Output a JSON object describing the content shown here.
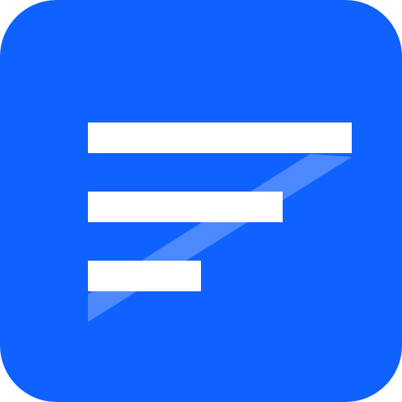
{
  "icon": {
    "name": "filter-lines-icon",
    "background_color": "#1062FE",
    "bar_color": "#FFFFFF",
    "sheen_color": "#FFFFFF",
    "sheen_opacity": 0.25
  }
}
